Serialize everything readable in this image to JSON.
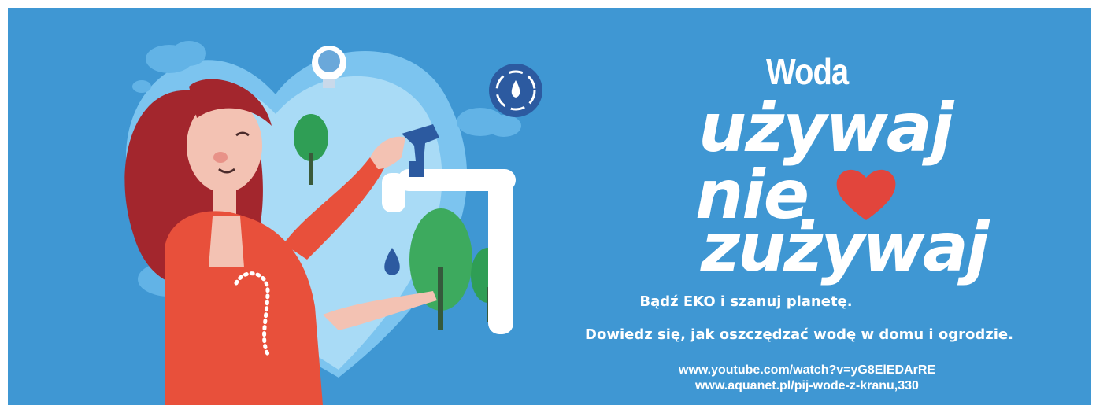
{
  "banner": {
    "title": {
      "line1": "Woda",
      "line2": "używaj",
      "line3": "nie",
      "line4": "zużywaj"
    },
    "tagline": {
      "line1": "Bądź EKO i szanuj planetę.",
      "line2": "Dowiedz się, jak oszczędzać wodę w domu i ogrodzie."
    },
    "links": [
      "www.youtube.com/watch?v=yG8ElEDArRE",
      "www.aquanet.pl/pij-wode-z-kranu,330"
    ],
    "icons": [
      "lightbulb-icon",
      "water-drop-recycle-icon",
      "heart-icon",
      "water-drop-icon"
    ],
    "colors": {
      "background": "#3f97d3",
      "heart": "#e2453c",
      "text": "#ffffff"
    }
  }
}
